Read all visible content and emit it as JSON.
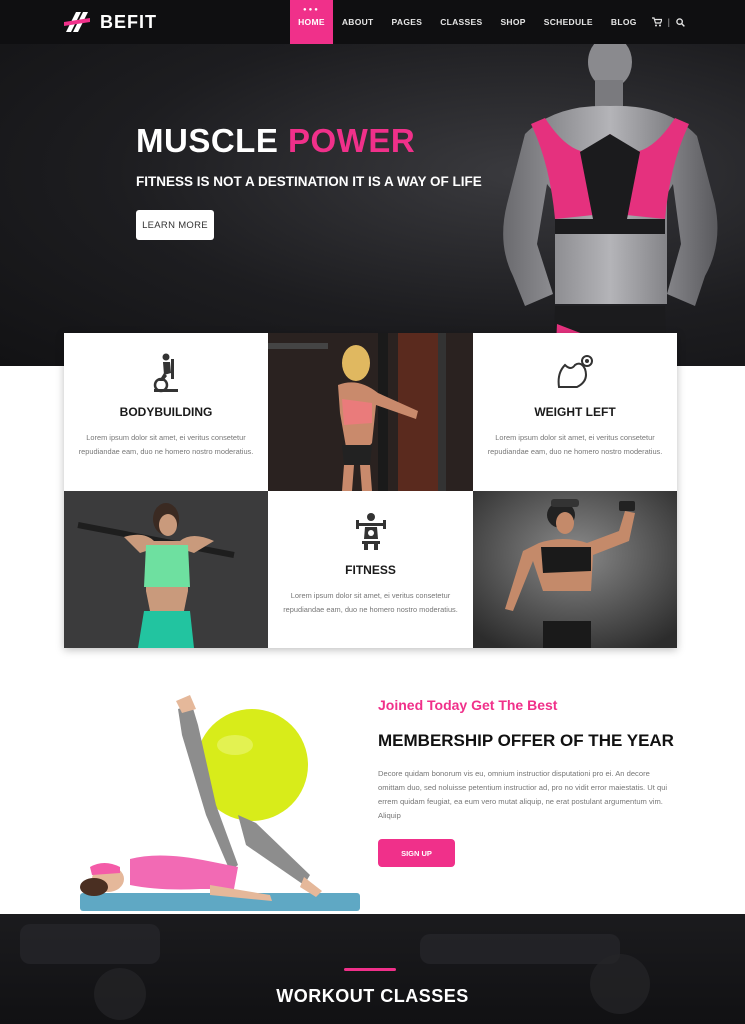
{
  "brand": {
    "name": "BEFIT"
  },
  "nav": {
    "items": [
      {
        "label": "HOME",
        "active": true
      },
      {
        "label": "ABOUT"
      },
      {
        "label": "PAGES"
      },
      {
        "label": "CLASSES"
      },
      {
        "label": "SHOP"
      },
      {
        "label": "SCHEDULE"
      },
      {
        "label": "BLOG"
      }
    ],
    "icons": [
      "cart-icon",
      "search-icon"
    ],
    "separator": "|"
  },
  "hero": {
    "title_white": "MUSCLE ",
    "title_accent": "POWER",
    "subtitle": "FITNESS IS NOT A DESTINATION IT IS A WAY OF LIFE",
    "button": "LEARN MORE"
  },
  "features": [
    {
      "title": "BODYBUILDING",
      "text": "Lorem ipsum dolor sit amet, ei veritus consetetur repudiandae eam, duo ne homero nostro moderatius.",
      "icon": "exercise-bike-icon"
    },
    {
      "title": "WEIGHT LEFT",
      "text": "Lorem ipsum dolor sit amet, ei veritus consetetur repudiandae eam, duo ne homero nostro moderatius.",
      "icon": "bicep-icon"
    },
    {
      "title": "FITNESS",
      "text": "Lorem ipsum dolor sit amet, ei veritus consetetur repudiandae eam, duo ne homero nostro moderatius.",
      "icon": "weightlifter-icon"
    }
  ],
  "membership": {
    "tagline": "Joined Today Get The Best",
    "title": "MEMBERSHIP OFFER OF THE YEAR",
    "description": "Decore quidam bonorum vis eu, omnium instructior disputationi pro ei. An decore omittam duo, sed noluisse petentium instructior ad, pro no vidit error maiestatis. Ut qui errem quidam feugiat, ea eum vero mutat aliquip, ne erat postulant argumentum vim. Aliquip",
    "button": "SIGN UP"
  },
  "workout": {
    "title": "WORKOUT CLASSES"
  },
  "colors": {
    "accent": "#f0308a",
    "dark": "#111113"
  }
}
